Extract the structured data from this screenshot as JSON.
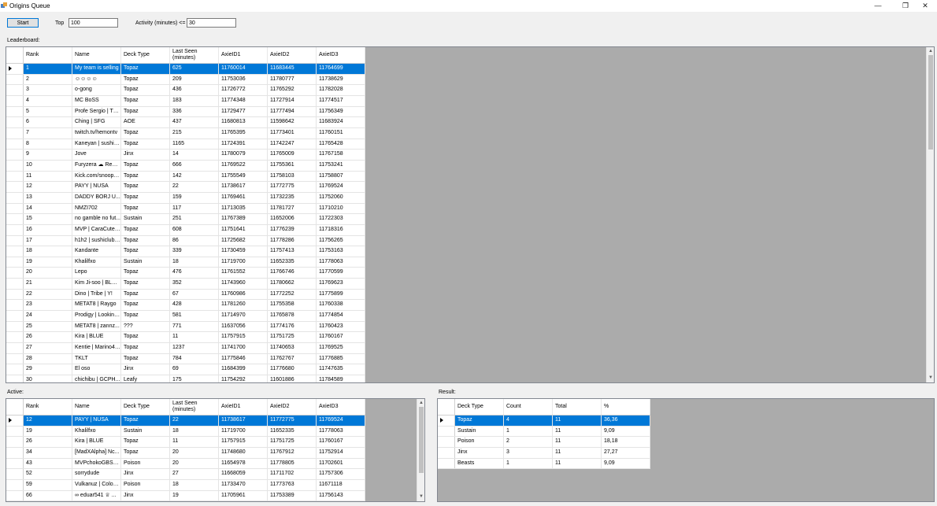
{
  "window": {
    "title": "Origins Queue"
  },
  "toolbar": {
    "start_label": "Start",
    "top_label": "Top",
    "top_value": "100",
    "activity_label": "Activity (minutes) <=",
    "activity_value": "30"
  },
  "leaderboard": {
    "label": "Leaderboard:",
    "columns": [
      "Rank",
      "Name",
      "Deck Type",
      "Last Seen\n(minutes)",
      "AxieID1",
      "AxieID2",
      "AxieID3"
    ],
    "rows": [
      [
        "1",
        "My team is selling",
        "Topaz",
        "625",
        "11760014",
        "11683445",
        "11764699"
      ],
      [
        "2",
        "☺☺☺☺",
        "Topaz",
        "209",
        "11753036",
        "11780777",
        "11738629"
      ],
      [
        "3",
        "o-gong",
        "Topaz",
        "436",
        "11726772",
        "11765292",
        "11782028"
      ],
      [
        "4",
        "MC BoSS",
        "Topaz",
        "183",
        "11774348",
        "11727914",
        "11774517"
      ],
      [
        "5",
        "Profe Sergio | TQ...",
        "Topaz",
        "336",
        "11729477",
        "11777494",
        "11756349"
      ],
      [
        "6",
        "Ching | SFG",
        "AOE",
        "437",
        "11680813",
        "11598642",
        "11683924"
      ],
      [
        "7",
        "twitch.tv/hemontv",
        "Topaz",
        "215",
        "11765395",
        "11773401",
        "11760151"
      ],
      [
        "8",
        "Kaneyan | sushicl...",
        "Topaz",
        "1165",
        "11724391",
        "11742247",
        "11765428"
      ],
      [
        "9",
        "Jove",
        "Jinx",
        "14",
        "11780079",
        "11765009",
        "11767158"
      ],
      [
        "10",
        "Furyzera ☁ Red ...",
        "Topaz",
        "666",
        "11769522",
        "11755361",
        "11753241"
      ],
      [
        "11",
        "Kick.com/snoopy...",
        "Topaz",
        "142",
        "11755549",
        "11758103",
        "11758807"
      ],
      [
        "12",
        "PAYY | NUSA",
        "Topaz",
        "22",
        "11738617",
        "11772775",
        "11769524"
      ],
      [
        "13",
        "DADDY BORJ U...",
        "Topaz",
        "159",
        "11769461",
        "11732235",
        "11752060"
      ],
      [
        "14",
        "NMZI702",
        "Topaz",
        "117",
        "11713035",
        "11781727",
        "11710210"
      ],
      [
        "15",
        "no gamble no fut...",
        "Sustain",
        "251",
        "11767389",
        "11652006",
        "11722303"
      ],
      [
        "16",
        "MVP | CaraCute | ...",
        "Topaz",
        "608",
        "11751641",
        "11776239",
        "11718316"
      ],
      [
        "17",
        "h1h2 | sushiclub I...",
        "Topaz",
        "86",
        "11725682",
        "11778286",
        "11756265"
      ],
      [
        "18",
        "Kandante",
        "Topaz",
        "339",
        "11730459",
        "11757413",
        "11753163"
      ],
      [
        "19",
        "Khalilfxo",
        "Sustain",
        "18",
        "11719700",
        "11652335",
        "11778063"
      ],
      [
        "20",
        "Lepo",
        "Topaz",
        "476",
        "11761552",
        "11766746",
        "11770599"
      ],
      [
        "21",
        "Kim Ji-soo | BLAC...",
        "Topaz",
        "352",
        "11743960",
        "11780662",
        "11769623"
      ],
      [
        "22",
        "Dino | Tribe | Y!",
        "Topaz",
        "67",
        "11760986",
        "11772252",
        "11775899"
      ],
      [
        "23",
        "METAT8 | Raygo",
        "Topaz",
        "428",
        "11781260",
        "11755358",
        "11760338"
      ],
      [
        "24",
        "Prodigy | Looking...",
        "Topaz",
        "581",
        "11714970",
        "11765878",
        "11774854"
      ],
      [
        "25",
        "METAT8 | zannz...",
        "???",
        "771",
        "11637056",
        "11774176",
        "11760423"
      ],
      [
        "26",
        "Kira | BLUE",
        "Topaz",
        "11",
        "11757915",
        "11751725",
        "11760167"
      ],
      [
        "27",
        "Kentie | Marino44...",
        "Topaz",
        "1237",
        "11741700",
        "11740653",
        "11769525"
      ],
      [
        "28",
        "TKLT",
        "Topaz",
        "784",
        "11775846",
        "11762767",
        "11776885"
      ],
      [
        "29",
        "El oso",
        "Jinx",
        "69",
        "11684399",
        "11776680",
        "11747635"
      ],
      [
        "30",
        "chichibu | GCPH...",
        "Leafy",
        "175",
        "11754292",
        "11601886",
        "11784589"
      ]
    ]
  },
  "active": {
    "label": "Active:",
    "columns": [
      "Rank",
      "Name",
      "Deck Type",
      "Last Seen\n(minutes)",
      "AxieID1",
      "AxieID2",
      "AxieID3"
    ],
    "rows": [
      [
        "12",
        "PAYY | NUSA",
        "Topaz",
        "22",
        "11738617",
        "11772775",
        "11769524"
      ],
      [
        "19",
        "Khalilfxo",
        "Sustain",
        "18",
        "11719700",
        "11652335",
        "11778063"
      ],
      [
        "26",
        "Kira | BLUE",
        "Topaz",
        "11",
        "11757915",
        "11751725",
        "11760167"
      ],
      [
        "34",
        "[MadXAlpha] Nc...",
        "Topaz",
        "20",
        "11748680",
        "11767912",
        "11752914"
      ],
      [
        "43",
        "MVPchokoGBSFG",
        "Poison",
        "20",
        "11654978",
        "11778805",
        "11702601"
      ],
      [
        "52",
        "sorrydude",
        "Jinx",
        "27",
        "11668059",
        "11711702",
        "11757306"
      ],
      [
        "59",
        "Vulkanuz | Colom...",
        "Poison",
        "18",
        "11733470",
        "11773763",
        "11671118"
      ],
      [
        "66",
        "∞ eduar541 ♕ ...",
        "Jinx",
        "19",
        "11705961",
        "11753389",
        "11756143"
      ]
    ]
  },
  "result": {
    "label": "Result:",
    "columns": [
      "Deck Type",
      "Count",
      "Total",
      "%"
    ],
    "rows": [
      [
        "Topaz",
        "4",
        "11",
        "36,36"
      ],
      [
        "Sustain",
        "1",
        "11",
        "9,09"
      ],
      [
        "Poison",
        "2",
        "11",
        "18,18"
      ],
      [
        "Jinx",
        "3",
        "11",
        "27,27"
      ],
      [
        "Beasts",
        "1",
        "11",
        "9,09"
      ]
    ]
  },
  "colors": {
    "selection": "#0078d7",
    "grid_bg": "#ababab"
  }
}
